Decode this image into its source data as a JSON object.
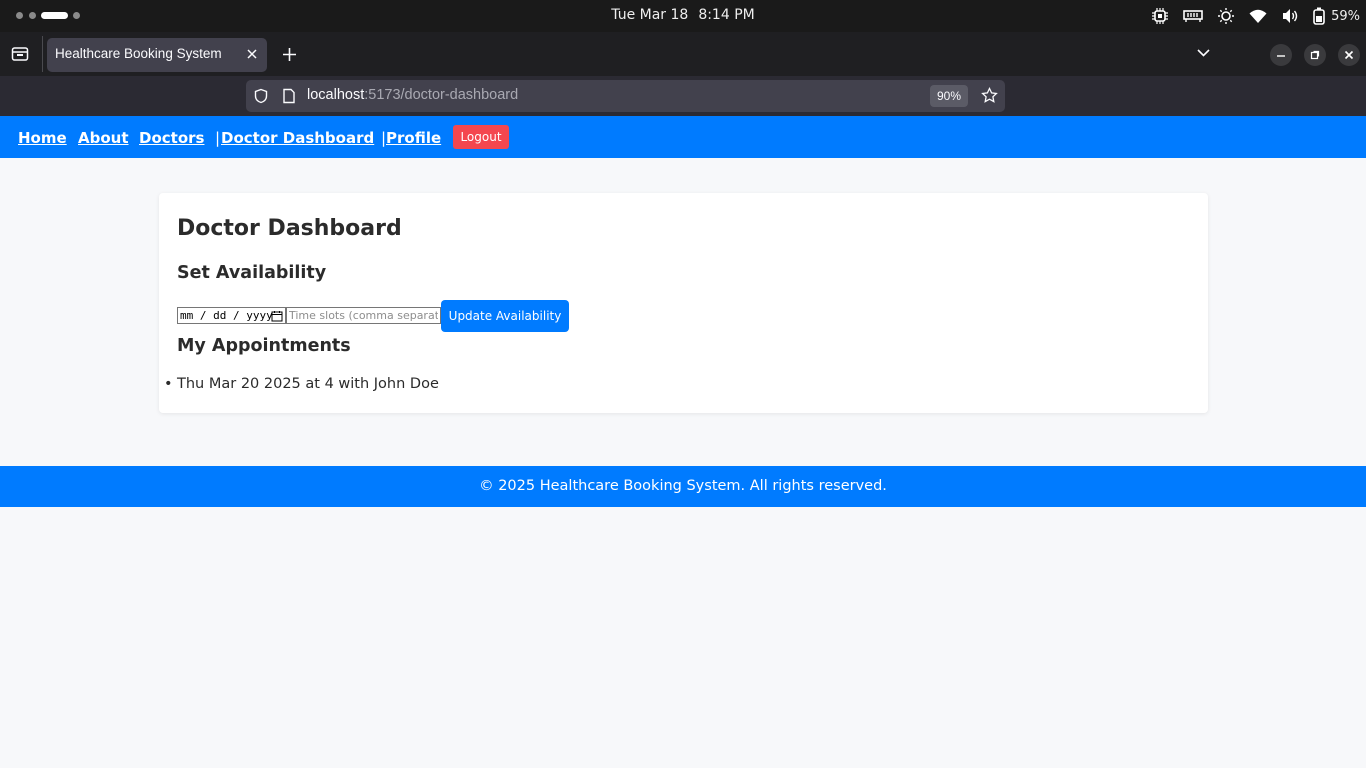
{
  "system": {
    "date": "Tue Mar 18",
    "time": "8:14 PM",
    "battery": "59%",
    "tray_icons": [
      "cpu-icon",
      "memory-icon",
      "brightness-icon",
      "wifi-icon",
      "volume-icon",
      "battery-icon"
    ]
  },
  "browser": {
    "tab_title": "Healthcare Booking System",
    "url_host": "localhost",
    "url_rest": ":5173/doctor-dashboard",
    "zoom": "90%"
  },
  "nav": {
    "home": "Home",
    "about": "About",
    "doctors": "Doctors",
    "sep1": "|",
    "doctor_dashboard": "Doctor Dashboard",
    "sep2": "|",
    "profile": "Profile",
    "logout": "Logout"
  },
  "dashboard": {
    "title": "Doctor Dashboard",
    "availability_heading": "Set Availability",
    "date_placeholder": "mm / dd / yyyy",
    "slots_placeholder": "Time slots (comma separated)",
    "update_button": "Update Availability",
    "appointments_heading": "My Appointments",
    "appointments": [
      "Thu Mar 20 2025 at 4 with John Doe"
    ]
  },
  "footer": {
    "text": "© 2025 Healthcare Booking System. All rights reserved."
  },
  "colors": {
    "primary": "#007bff",
    "danger": "#f4474f",
    "page_bg": "#f7f8fa"
  }
}
